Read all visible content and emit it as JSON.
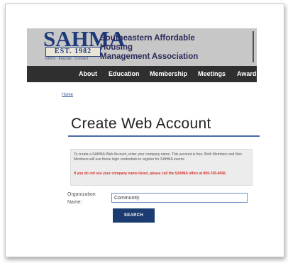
{
  "header": {
    "logo_text": "SAHMA",
    "logo_est": "EST. 1982",
    "logo_tagline": "Inform · Educate · Connect",
    "org_line1": "Southeastern Affordable Housing",
    "org_line2": "Management Association"
  },
  "nav": {
    "items": [
      {
        "label": "About"
      },
      {
        "label": "Education"
      },
      {
        "label": "Membership"
      },
      {
        "label": "Meetings"
      },
      {
        "label": "Awards"
      }
    ]
  },
  "breadcrumb": {
    "home": "Home"
  },
  "page": {
    "title": "Create Web Account",
    "info": "To create a SAHMA Web Account, enter your company name. This account is free. Both Members and Non Members will use these login credentials to register for SAHMA events.",
    "warning": "If you do not see your company name listed, please call the SAHMA office at 800-745-4066."
  },
  "form": {
    "org_label": "Organization Name:",
    "org_value": "Community",
    "search_label": "SEARCH"
  },
  "colors": {
    "nav_bg": "#2f2f2f",
    "brand_blue": "#1c3b70",
    "warning_red": "#d8322a",
    "rule_blue": "#4a6aa8"
  }
}
